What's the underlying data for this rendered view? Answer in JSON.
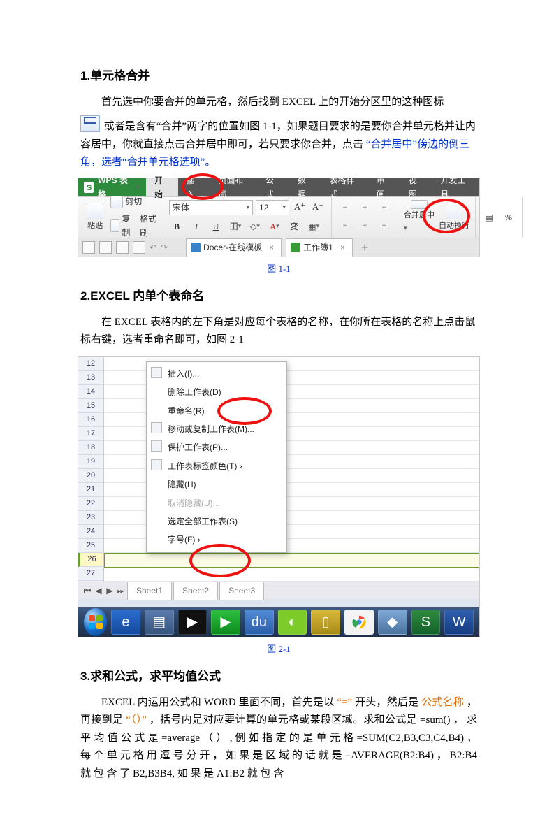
{
  "section1": {
    "heading": "1.单元格合并",
    "p1_a": "首先选中你要合并的单元格，然后找到 EXCEL 上的开始分区里的这种图标",
    "p1_b": "或者是含有“合并”两字的位置如图 1-1，如果题目要求的是要你合并单元格并让内容居中，你就直接点击合并居中即可，若只要求你合并，点击",
    "p1_c_blue": "“合并居中”傍边的倒三角，选者“合并单元格选项”。"
  },
  "fig1": {
    "app": "WPS 表格",
    "tabs": [
      "开始",
      "插入",
      "页面布局",
      "公式",
      "数据",
      "表格样式",
      "审阅",
      "视图",
      "开发工具"
    ],
    "clipboard": {
      "paste": "粘贴",
      "cut": "剪切",
      "copy": "复制",
      "fmtpaint": "格式刷"
    },
    "font": {
      "name": "宋体",
      "size": "12"
    },
    "merge_label": "合并居中",
    "wrap_label": "自动换行",
    "doc_tab1": "Docer-在线模板",
    "doc_tab2": "工作簿1",
    "caption": "图 1-1"
  },
  "section2": {
    "heading": "2.EXCEL 内单个表命名",
    "p1": "在 EXCEL 表格内的左下角是对应每个表格的名称，在你所在表格的名称上点击鼠标右键，选者重命名即可，如图 2-1"
  },
  "fig2": {
    "rows": [
      "12",
      "13",
      "14",
      "15",
      "16",
      "17",
      "18",
      "19",
      "20",
      "21",
      "22",
      "23",
      "24",
      "25",
      "26",
      "27"
    ],
    "active_row": "26",
    "context_menu": {
      "insert": "插入(I)...",
      "del": "删除工作表(D)",
      "rename": "重命名(R)",
      "move": "移动或复制工作表(M)...",
      "protect": "保护工作表(P)...",
      "tabcolor": "工作表标签颜色(T)",
      "hide": "隐藏(H)",
      "unhide": "取消隐藏(U)...",
      "selectall": "选定全部工作表(S)",
      "fontsize": "字号(F)"
    },
    "sheet_tabs": [
      "Sheet1",
      "Sheet2",
      "Sheet3"
    ],
    "caption": "图 2-1"
  },
  "section3": {
    "heading": "3.求和公式，求平均值公式",
    "para_a": "EXCEL 内运用公式和 WORD 里面不同，首先是以",
    "para_b": "“=”",
    "para_c": "开头，然后是",
    "para_d": "公式名称",
    "para_e": "，再接到是",
    "para_f": "“（）”",
    "para_g": "，括号内是对应要计算的单元格或某段区域。求和公式是 =sum() ， 求 平 均 值 公 式 是 =average （ ） , 例 如 指 定 的 是 单 元 格 =SUM(C2,B3,C3,C4,B4) ， 每 个 单 元 格 用 逗 号 分 开 ， 如 果 是 区 域 的 话 就 是 =AVERAGE(B2:B4) ， B2:B4 就 包 含 了 B2,B3B4, 如 果 是 A1:B2 就 包 含"
  }
}
